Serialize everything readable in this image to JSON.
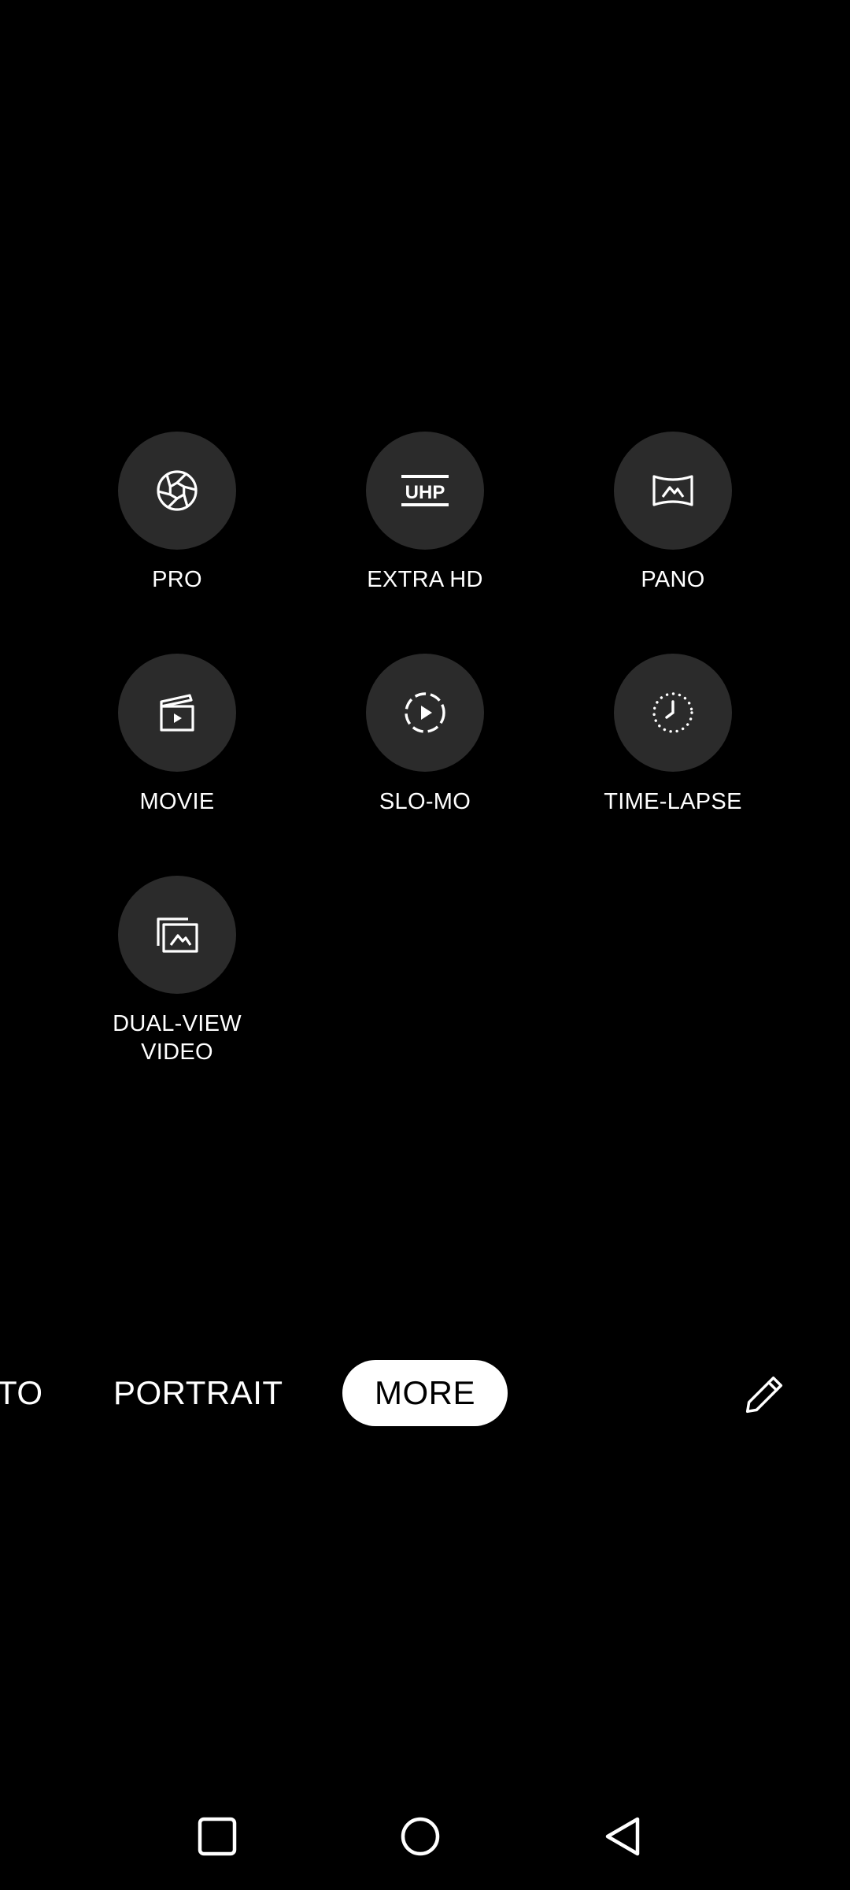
{
  "modes": [
    {
      "label": "PRO",
      "icon": "aperture-icon"
    },
    {
      "label": "EXTRA HD",
      "icon": "uhp-icon",
      "icon_text": "UHP"
    },
    {
      "label": "PANO",
      "icon": "panorama-icon"
    },
    {
      "label": "MOVIE",
      "icon": "clapperboard-icon"
    },
    {
      "label": "SLO-MO",
      "icon": "slow-motion-icon"
    },
    {
      "label": "TIME-LAPSE",
      "icon": "time-lapse-icon"
    },
    {
      "label": "DUAL-VIEW\nVIDEO",
      "icon": "dual-view-icon"
    }
  ],
  "mode_bar": {
    "photo_label": "TO",
    "portrait_label": "PORTRAIT",
    "more_label": "MORE",
    "edit_icon": "pencil-icon"
  },
  "nav": {
    "recents_icon": "square-icon",
    "home_icon": "circle-icon",
    "back_icon": "triangle-back-icon"
  },
  "colors": {
    "background": "#000000",
    "circle": "#2b2b2b",
    "text": "#ffffff",
    "selected_pill": "#ffffff"
  }
}
